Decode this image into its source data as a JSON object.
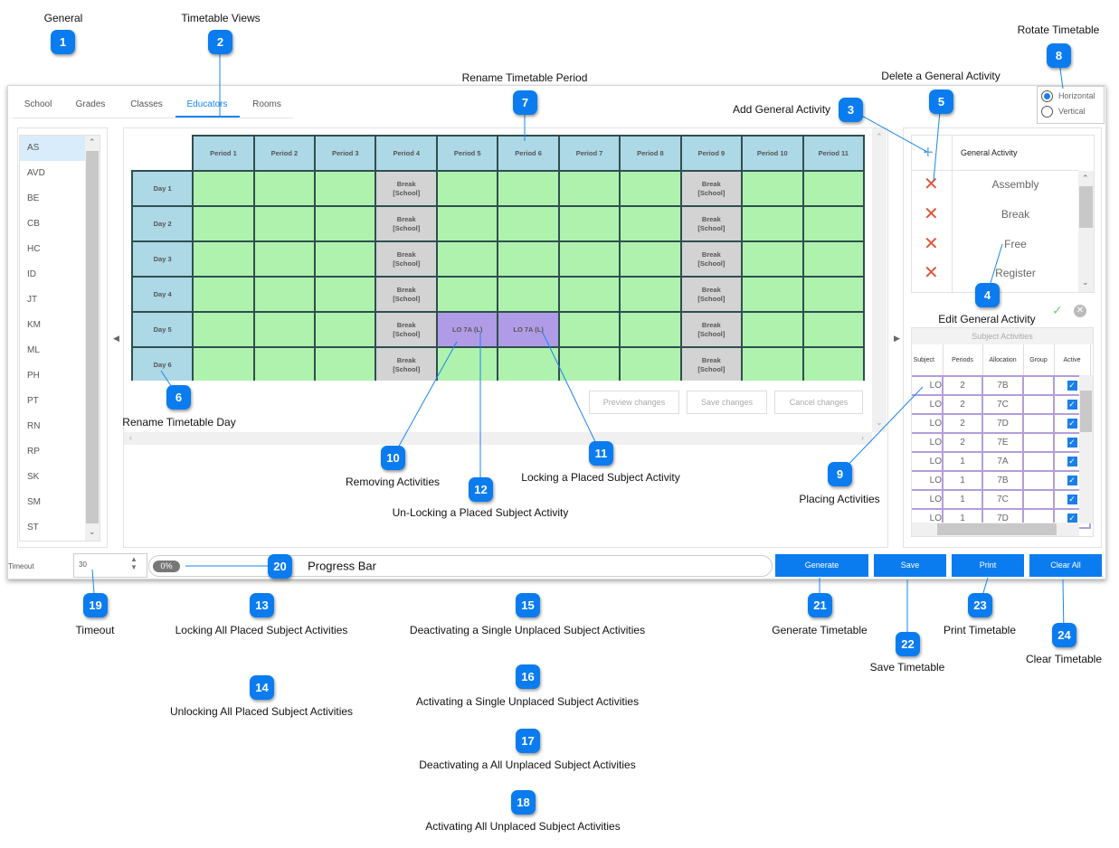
{
  "tabs": [
    {
      "label": "School"
    },
    {
      "label": "Grades"
    },
    {
      "label": "Classes"
    },
    {
      "label": "Educators",
      "active": true
    },
    {
      "label": "Rooms"
    }
  ],
  "educators": [
    "AS",
    "AVD",
    "BE",
    "CB",
    "HC",
    "ID",
    "JT",
    "KM",
    "ML",
    "PH",
    "PT",
    "RN",
    "RP",
    "SK",
    "SM",
    "ST"
  ],
  "selected_educator": "AS",
  "timetable": {
    "periods": [
      "Period 1",
      "Period 2",
      "Period 3",
      "Period 4",
      "Period 5",
      "Period 6",
      "Period 7",
      "Period 8",
      "Period 9",
      "Period 10",
      "Period 11"
    ],
    "days": [
      {
        "label": "Day 1",
        "cells": [
          "",
          "",
          "",
          "Break\n[School]",
          "",
          "",
          "",
          "",
          "Break\n[School]",
          "",
          ""
        ]
      },
      {
        "label": "Day 2",
        "cells": [
          "",
          "",
          "",
          "Break\n[School]",
          "",
          "",
          "",
          "",
          "Break\n[School]",
          "",
          ""
        ]
      },
      {
        "label": "Day 3",
        "cells": [
          "",
          "",
          "",
          "Break\n[School]",
          "",
          "",
          "",
          "",
          "Break\n[School]",
          "",
          ""
        ]
      },
      {
        "label": "Day 4",
        "cells": [
          "",
          "",
          "",
          "Break\n[School]",
          "",
          "",
          "",
          "",
          "Break\n[School]",
          "",
          ""
        ]
      },
      {
        "label": "Day 5",
        "cells": [
          "",
          "",
          "",
          "Break\n[School]",
          "LO 7A (L)",
          "LO 7A (L)",
          "",
          "",
          "Break\n[School]",
          "",
          ""
        ]
      },
      {
        "label": "Day 6",
        "cells": [
          "",
          "",
          "",
          "Break\n[School]",
          "",
          "",
          "",
          "",
          "Break\n[School]",
          "",
          ""
        ]
      }
    ],
    "colors": {
      "header": "#add8e6",
      "free": "#aef2ae",
      "break": "#d3d3d3",
      "subject": "#b09ce6",
      "border": "#2f4f4f"
    }
  },
  "grid_buttons": {
    "preview": "Preview changes",
    "save": "Save changes",
    "cancel": "Cancel changes"
  },
  "rotate": {
    "options": [
      "Horizontal",
      "Vertical"
    ],
    "selected": "Horizontal"
  },
  "general_activities": {
    "header": "General Activity",
    "items": [
      "Assembly",
      "Break",
      "Free",
      "Register"
    ]
  },
  "subject_activities": {
    "title": "Subject Activities",
    "columns": [
      "Subject",
      "Periods",
      "Allocation",
      "Group",
      "Active"
    ],
    "rows": [
      [
        "LO",
        "2",
        "7B",
        "",
        true
      ],
      [
        "LO",
        "2",
        "7C",
        "",
        true
      ],
      [
        "LO",
        "2",
        "7D",
        "",
        true
      ],
      [
        "LO",
        "2",
        "7E",
        "",
        true
      ],
      [
        "LO",
        "1",
        "7A",
        "",
        true
      ],
      [
        "LO",
        "1",
        "7B",
        "",
        true
      ],
      [
        "LO",
        "1",
        "7C",
        "",
        true
      ],
      [
        "LO",
        "1",
        "7D",
        "",
        true
      ]
    ]
  },
  "bottom": {
    "timeout_label": "Timeout",
    "timeout_value": "30",
    "progress_text": "0%",
    "progress_percent": 0,
    "generate": "Generate",
    "save": "Save",
    "print": "Print",
    "clear": "Clear All"
  },
  "accent": "#0a7cf0",
  "callouts": [
    {
      "n": "1",
      "label": "General"
    },
    {
      "n": "2",
      "label": "Timetable Views"
    },
    {
      "n": "3",
      "label": "Add General Activity"
    },
    {
      "n": "4",
      "label": "Edit General Activity"
    },
    {
      "n": "5",
      "label": "Delete a General Activity"
    },
    {
      "n": "6",
      "label": "Rename Timetable Day"
    },
    {
      "n": "7",
      "label": "Rename Timetable Period"
    },
    {
      "n": "8",
      "label": "Rotate Timetable"
    },
    {
      "n": "9",
      "label": "Placing Activities"
    },
    {
      "n": "10",
      "label": "Removing Activities"
    },
    {
      "n": "11",
      "label": "Locking a Placed Subject Activity"
    },
    {
      "n": "12",
      "label": "Un-Locking a Placed Subject Activity"
    },
    {
      "n": "13",
      "label": "Locking All Placed Subject Activities"
    },
    {
      "n": "14",
      "label": "Unlocking All Placed Subject Activities"
    },
    {
      "n": "15",
      "label": "Deactivating a Single Unplaced Subject Activities"
    },
    {
      "n": "16",
      "label": "Activating a Single Unplaced Subject Activities"
    },
    {
      "n": "17",
      "label": "Deactivating a All Unplaced Subject Activities"
    },
    {
      "n": "18",
      "label": "Activating All Unplaced Subject Activities"
    },
    {
      "n": "19",
      "label": "Timeout"
    },
    {
      "n": "20",
      "label": "Progress Bar"
    },
    {
      "n": "21",
      "label": "Generate Timetable"
    },
    {
      "n": "22",
      "label": "Save Timetable"
    },
    {
      "n": "23",
      "label": "Print Timetable"
    },
    {
      "n": "24",
      "label": "Clear Timetable"
    }
  ]
}
